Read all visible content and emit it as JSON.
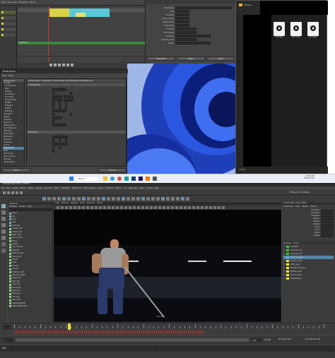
{
  "top_left": {
    "dope_title": "Dope Sheet",
    "menu": [
      "Edit",
      "View",
      "Key",
      "Tangents",
      "Show"
    ],
    "track_names": [
      "Dopesheet Summary",
      "",
      "",
      "",
      ""
    ],
    "summary_label": "Summary",
    "key_color": "#3a8a3a"
  },
  "timebar": {
    "frames": [
      "1",
      "10",
      "20",
      "30",
      "40",
      "50",
      "60",
      "70",
      "80",
      "90",
      "100",
      "110",
      "120"
    ]
  },
  "playback_dialog_top": {
    "fields": [
      "Playblast",
      "File",
      "Current",
      "Time range",
      "Start time",
      "End time",
      "Format",
      "Encoding",
      "Quality",
      "Display size",
      "Scale"
    ],
    "buttons": [
      "Playblast",
      "Apply",
      "Close"
    ]
  },
  "preferences": {
    "title": "Preferences",
    "menu": [
      "Edit",
      "Help"
    ],
    "categories_header": "Categories",
    "categories": [
      "Interface",
      "UI Elements",
      "Help",
      "Display",
      "Kinematics",
      "Animation",
      "Manipulators",
      "NURBS",
      "Polygons",
      "Subdiv",
      "Settings",
      "Animation",
      "Assets",
      "Cameras",
      "Dynamics",
      "Files/Projects",
      "File References",
      "Modeling",
      "Node Editor",
      "Rendering",
      "Selection",
      "Snapping",
      "Sound",
      "Time Slider",
      "Undo",
      "GPU Cache",
      "Save Actions",
      "Modules",
      "Applications"
    ],
    "selected_category": "Time Slider",
    "heading": "Time Slider: Animation Time Slider and Playback Preferences",
    "section1": "Time Slider",
    "section2": "Playback",
    "save_label": "Save",
    "cancel_label": "Cancel"
  },
  "files_window": {
    "title": "Filmes",
    "files": [
      {
        "name": "Ol video"
      },
      {
        "name": "SEI video"
      },
      {
        "name": "03 video"
      }
    ],
    "status": "3 items"
  },
  "taskbar": {
    "search_label": "Search",
    "time": "11:45 AM",
    "date": "2023-10-19"
  },
  "maya_main": {
    "title": "Autodesk Maya 2024: untitled*",
    "menu": [
      "File",
      "Edit",
      "Create",
      "Select",
      "Modify",
      "Display",
      "Windows",
      "Mesh",
      "Edit Mesh",
      "Mesh Tools",
      "Mesh Display",
      "Curves",
      "Surfaces",
      "Deform",
      "UV",
      "Generate",
      "Cache",
      "Arnold",
      "Help"
    ],
    "workspace_label": "Workspace: Animation",
    "outliner_title": "Outliner",
    "outliner_menu": [
      "Display",
      "Show",
      "Help"
    ],
    "outliner_items": [
      "persp",
      "top",
      "front",
      "side",
      "camera1",
      "shader_root",
      "Gallery_Set",
      "Peter_shot",
      "Ground_Set",
      "Plane",
      "Ladder",
      "Rig_Controls",
      "Skeleton",
      "Skeleton_Rig",
      "Scene_Set",
      "Plane1",
      "Cube",
      "Group1",
      "group2",
      "Skeleton_Left",
      "Skeleton_Right",
      "pelvis_Ctrl",
      "Hips_Rig",
      "Foot_Ctrl",
      "Spine_Rig",
      "Spine_ctrl",
      "Neck_Rig",
      "Arm_Rig",
      "Hand_Ctrl",
      "defaultLightSet",
      "defaultObjectSet"
    ],
    "viewport_menu": [
      "View",
      "Shading",
      "Lighting",
      "Show",
      "Renderer",
      "Panels"
    ],
    "viewport_cam_label": "shotcam",
    "channel_box_title": "Channel Box / Layer Editor",
    "channel_menu": [
      "Channels",
      "Edit",
      "Object",
      "Show"
    ],
    "channel_attrs": [
      "Translate X",
      "Translate Y",
      "Translate Z",
      "Rotate X",
      "Rotate Y",
      "Rotate Z",
      "Scale X",
      "Scale Y",
      "Scale Z",
      "Visibility"
    ],
    "layer_tabs": [
      "Display",
      "Anim"
    ],
    "layers": [
      {
        "name": "sceneFile",
        "color": "#3c3"
      },
      {
        "name": "character_rig",
        "color": "#3c3"
      },
      {
        "name": "character_fix",
        "color": "#3c3"
      },
      {
        "name": "Controls_layer",
        "color": "#6af"
      },
      {
        "name": "scenery_layer",
        "color": "#ee3"
      },
      {
        "name": "lights_layer",
        "color": "#ee3"
      },
      {
        "name": "BackgroundLayer",
        "color": "#ee3"
      },
      {
        "name": "BOARD_layer",
        "color": "#ee3"
      },
      {
        "name": "Ground_layer",
        "color": "#ee3"
      },
      {
        "name": "defaultLayer",
        "color": "#ee3"
      }
    ],
    "current_frame": "46",
    "range_start": "1",
    "range_end": "120",
    "fps": "24 fps",
    "character_set": "No Character Set",
    "anim_layer": "No Anim Layer",
    "mel_label": "MEL"
  }
}
